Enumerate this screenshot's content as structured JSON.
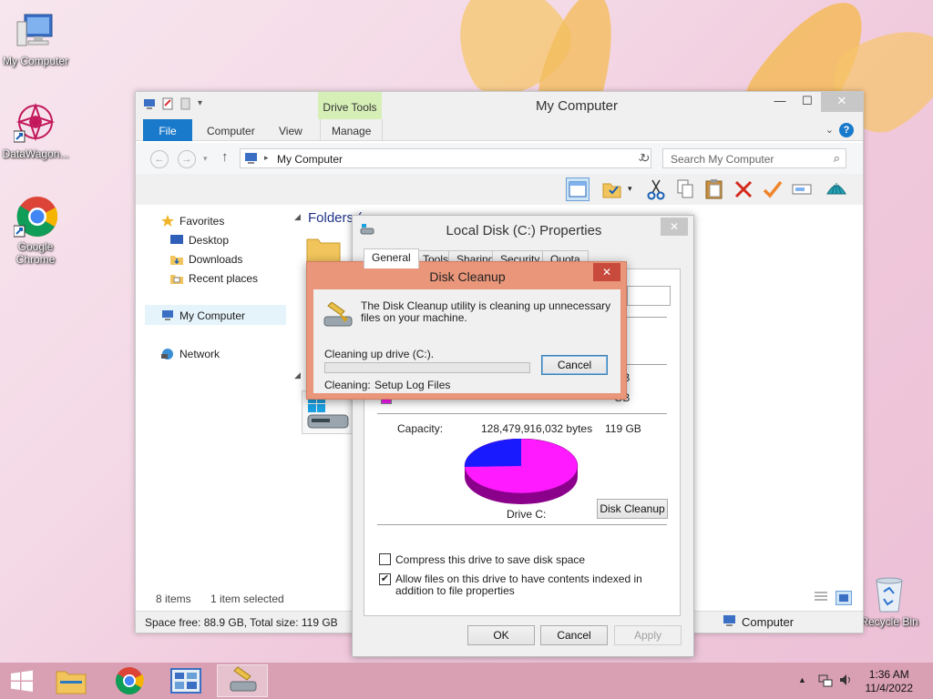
{
  "desktop": {
    "icons": [
      {
        "label": "My Computer"
      },
      {
        "label": "DataWagon..."
      },
      {
        "label": "Google Chrome"
      },
      {
        "label": "Recycle Bin"
      }
    ]
  },
  "explorer": {
    "title": "My Computer",
    "context_tab": "Drive Tools",
    "tabs": {
      "file": "File",
      "computer": "Computer",
      "view": "View",
      "manage": "Manage"
    },
    "address": "My Computer",
    "search_placeholder": "Search My Computer",
    "nav": {
      "favorites": "Favorites",
      "desktop": "Desktop",
      "downloads": "Downloads",
      "recent": "Recent places",
      "my_computer": "My Computer",
      "network": "Network"
    },
    "content": {
      "folders_header": "Folders (6)"
    },
    "status": {
      "items": "8 items",
      "selected": "1 item selected"
    },
    "details": {
      "space": "Space free: 88.9 GB, Total size: 119 GB",
      "computer": "Computer"
    }
  },
  "properties": {
    "title": "Local Disk (C:) Properties",
    "tabs": [
      "General",
      "Tools",
      "Sharing",
      "Security",
      "Quota"
    ],
    "used_size": "GB",
    "free_size": "GB",
    "capacity_label": "Capacity:",
    "capacity_bytes": "128,479,916,032 bytes",
    "capacity_gb": "119 GB",
    "drive_label": "Drive C:",
    "disk_cleanup_button": "Disk Cleanup",
    "compress_label": "Compress this drive to save disk space",
    "compress_checked": false,
    "index_label": "Allow files on this drive to have contents indexed in addition to file properties",
    "index_checked": true,
    "ok": "OK",
    "cancel": "Cancel",
    "apply": "Apply",
    "pie": {
      "used_fraction": 0.255,
      "used_color": "#1a1aff",
      "free_color": "#ff1aff"
    }
  },
  "disk_cleanup": {
    "title": "Disk Cleanup",
    "message": "The Disk Cleanup utility is cleaning up unnecessary files on your machine.",
    "progress_label": "Cleaning up drive  (C:).",
    "progress": 0.0,
    "cancel": "Cancel",
    "cleaning_label": "Cleaning:",
    "cleaning_item": "Setup Log Files"
  },
  "taskbar": {
    "time": "1:36 AM",
    "date": "11/4/2022"
  },
  "colors": {
    "accent": "#1979ca",
    "disk_cleanup_frame": "#e9967a",
    "taskbar": "#d9a0b4"
  }
}
